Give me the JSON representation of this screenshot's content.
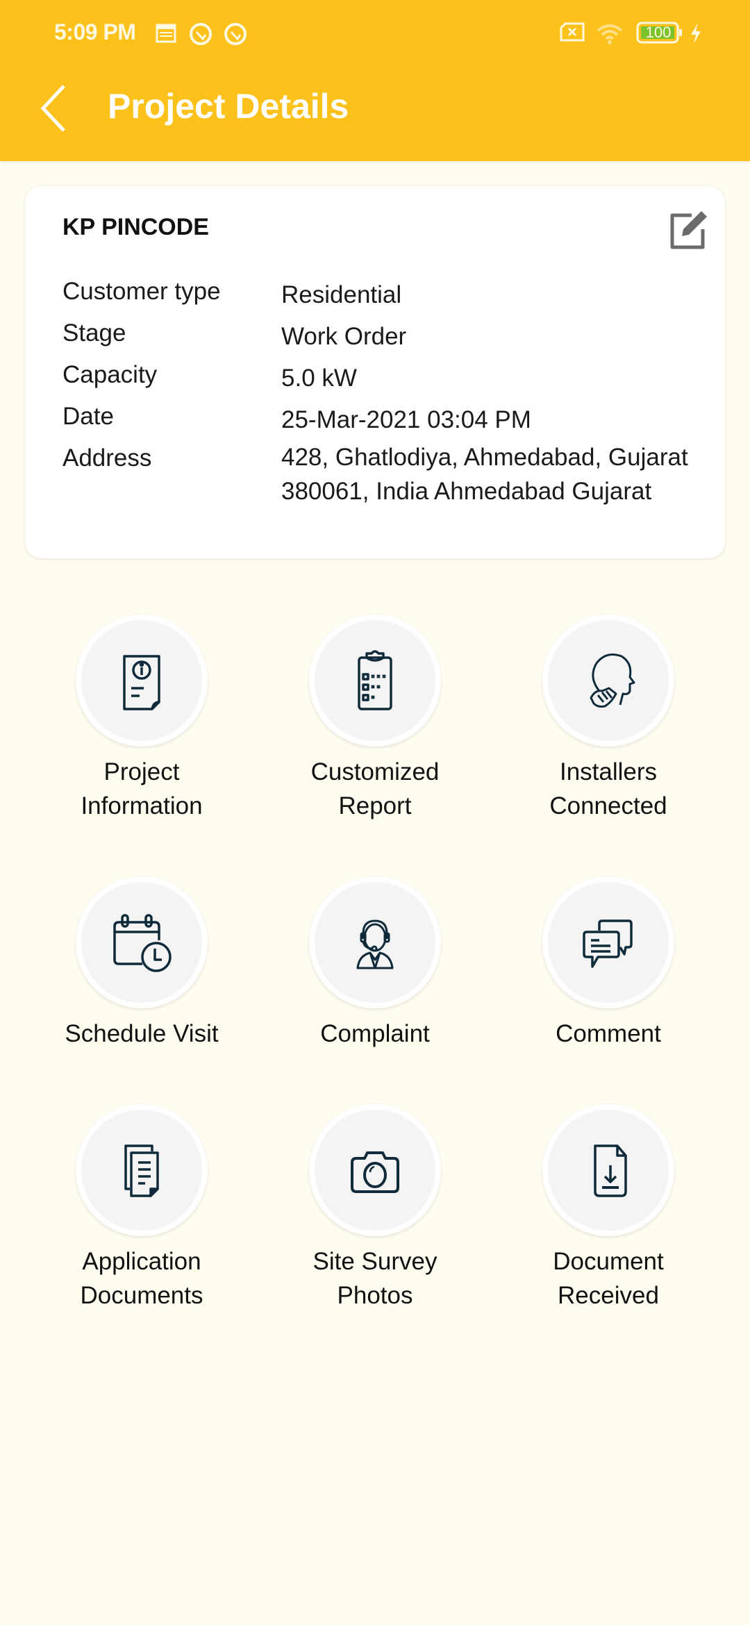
{
  "status_bar": {
    "time": "5:09 PM",
    "battery": "100",
    "icons": [
      "calendar-icon",
      "app-notification-icon",
      "app-notification-icon",
      "no-sim-icon",
      "wifi-icon",
      "battery-icon",
      "charging-icon"
    ]
  },
  "header": {
    "title": "Project Details",
    "back_icon": "chevron-left-icon"
  },
  "project_card": {
    "name": "KP PINCODE",
    "edit_icon": "edit-icon",
    "fields": [
      {
        "label": "Customer type",
        "value": "Residential"
      },
      {
        "label": "Stage",
        "value": "Work Order"
      },
      {
        "label": "Capacity",
        "value": "5.0 kW"
      },
      {
        "label": "Date",
        "value": "25-Mar-2021 03:04 PM"
      },
      {
        "label": "Address",
        "value": "428, Ghatlodiya, Ahmedabad, Gujarat 380061, India Ahmedabad Gujarat"
      }
    ]
  },
  "actions": [
    {
      "label": "Project Information",
      "icon": "document-info-icon"
    },
    {
      "label": "Customized Report",
      "icon": "clipboard-checklist-icon"
    },
    {
      "label": "Installers Connected",
      "icon": "handshake-head-icon"
    },
    {
      "label": "Schedule Visit",
      "icon": "calendar-clock-icon"
    },
    {
      "label": "Complaint",
      "icon": "support-agent-icon"
    },
    {
      "label": "Comment",
      "icon": "chat-bubbles-icon"
    },
    {
      "label": "Application Documents",
      "icon": "documents-icon"
    },
    {
      "label": "Site Survey Photos",
      "icon": "camera-icon"
    },
    {
      "label": "Document Received",
      "icon": "document-download-icon"
    }
  ],
  "colors": {
    "accent": "#fdc11c",
    "background": "#fffcf0",
    "icon_stroke": "#0f2a3a"
  }
}
